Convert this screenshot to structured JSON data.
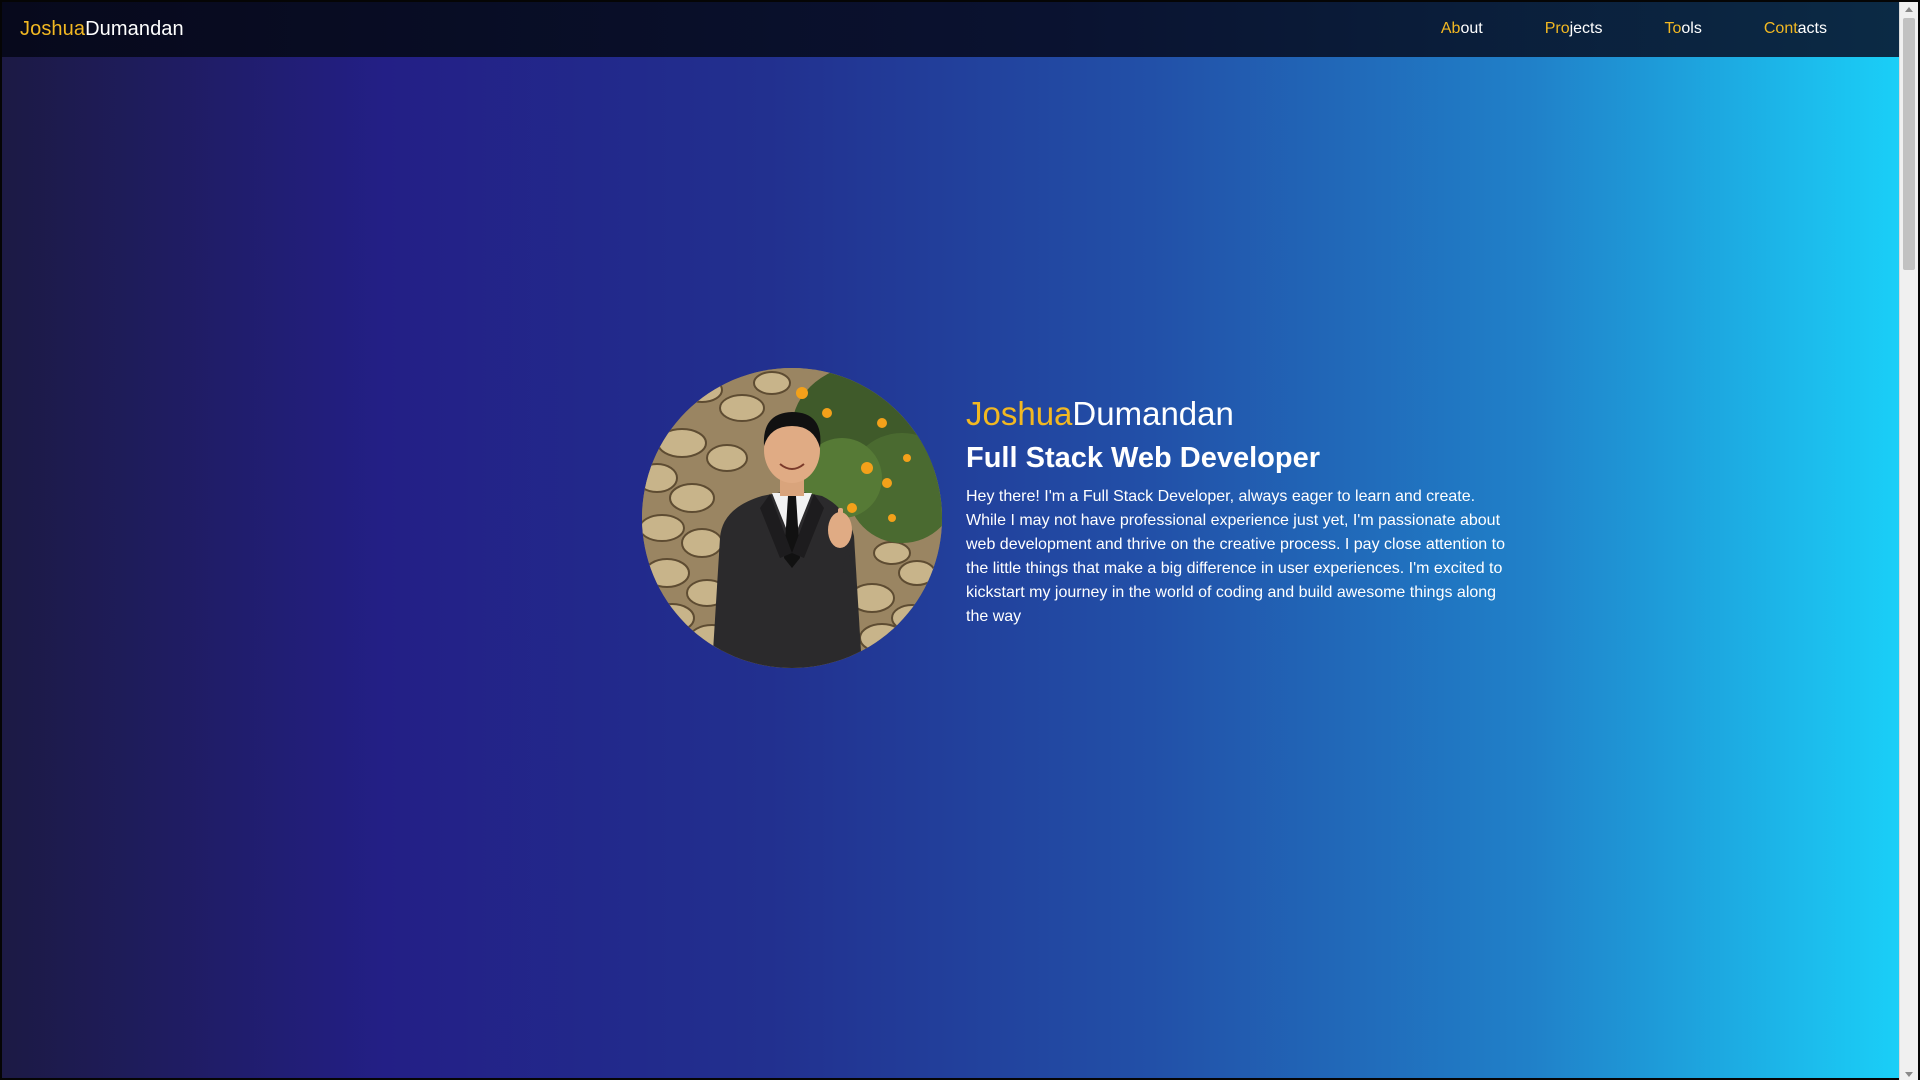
{
  "brand": {
    "first": "Joshua",
    "last": "Dumandan"
  },
  "nav": {
    "items": [
      {
        "highlight": "Ab",
        "rest": "out"
      },
      {
        "highlight": "Pro",
        "rest": "jects"
      },
      {
        "highlight": "To",
        "rest": "ols"
      },
      {
        "highlight": "Cont",
        "rest": "acts"
      }
    ]
  },
  "hero": {
    "first": "Joshua",
    "last": "Dumandan",
    "title": "Full Stack Web Developer",
    "bio": "Hey there! I'm a Full Stack Developer, always eager to learn and create. While I may not have professional experience just yet, I'm passionate about web development and thrive on the creative process. I pay close attention to the little things that make a big difference in user experiences. I'm excited to kickstart my journey in the world of coding and build awesome things along the way"
  },
  "colors": {
    "accent": "#f2b822",
    "text": "#ffffff",
    "gradient_start": "#1c1a44",
    "gradient_end": "#1ad3fa"
  }
}
